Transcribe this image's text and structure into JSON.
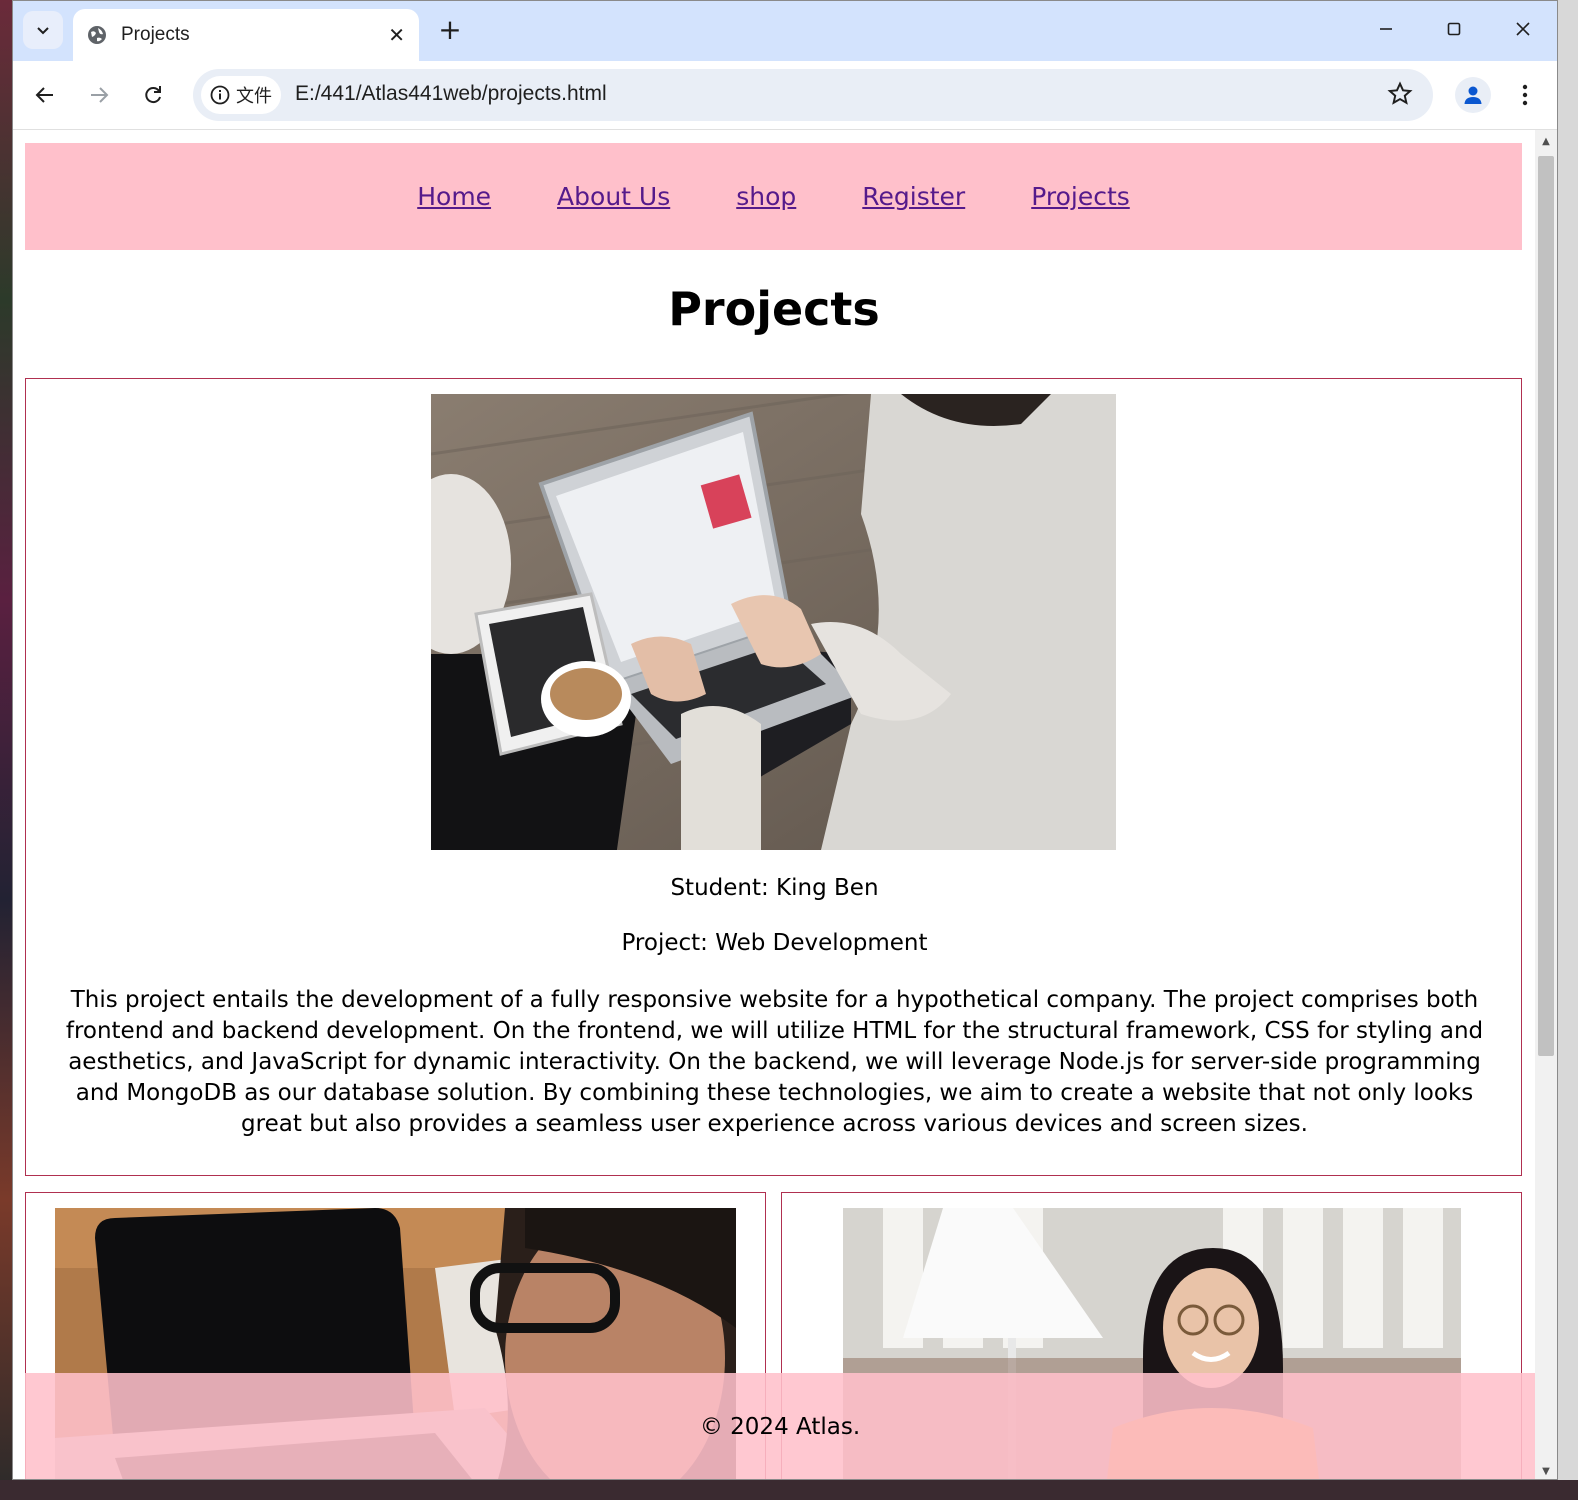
{
  "browser": {
    "tab_title": "Projects",
    "tab_close": "✕",
    "new_tab": "+",
    "site_chip_label": "文件",
    "url": "E:/441/Atlas441web/projects.html",
    "window_controls": {
      "minimize": "—",
      "maximize": "☐",
      "close": "✕"
    }
  },
  "nav": {
    "items": [
      {
        "label": "Home"
      },
      {
        "label": "About Us"
      },
      {
        "label": "shop"
      },
      {
        "label": "Register"
      },
      {
        "label": "Projects"
      }
    ]
  },
  "page": {
    "title": "Projects"
  },
  "projects": [
    {
      "student": "Student: King Ben",
      "project": "Project: Web Development",
      "description": "This project entails the development of a fully responsive website for a hypothetical company. The project comprises both frontend and backend development. On the frontend, we will utilize HTML for the structural framework, CSS for styling and aesthetics, and JavaScript for dynamic interactivity. On the backend, we will leverage Node.js for server-side programming and MongoDB as our database solution. By combining these technologies, we aim to create a website that not only looks great but also provides a seamless user experience across various devices and screen sizes."
    }
  ],
  "footer": {
    "text": "© 2024 Atlas."
  },
  "colors": {
    "nav_bg": "#ffc0cb",
    "link": "#551a8b",
    "card_border": "#b03050",
    "tabstrip": "#d3e3fd"
  },
  "icons": {
    "tab_search": "chevron-down-icon",
    "favicon": "globe-icon",
    "back": "arrow-left-icon",
    "forward": "arrow-right-icon",
    "reload": "reload-icon",
    "site_info": "info-icon",
    "bookmark": "star-icon",
    "profile": "person-icon",
    "menu": "kebab-menu-icon"
  }
}
